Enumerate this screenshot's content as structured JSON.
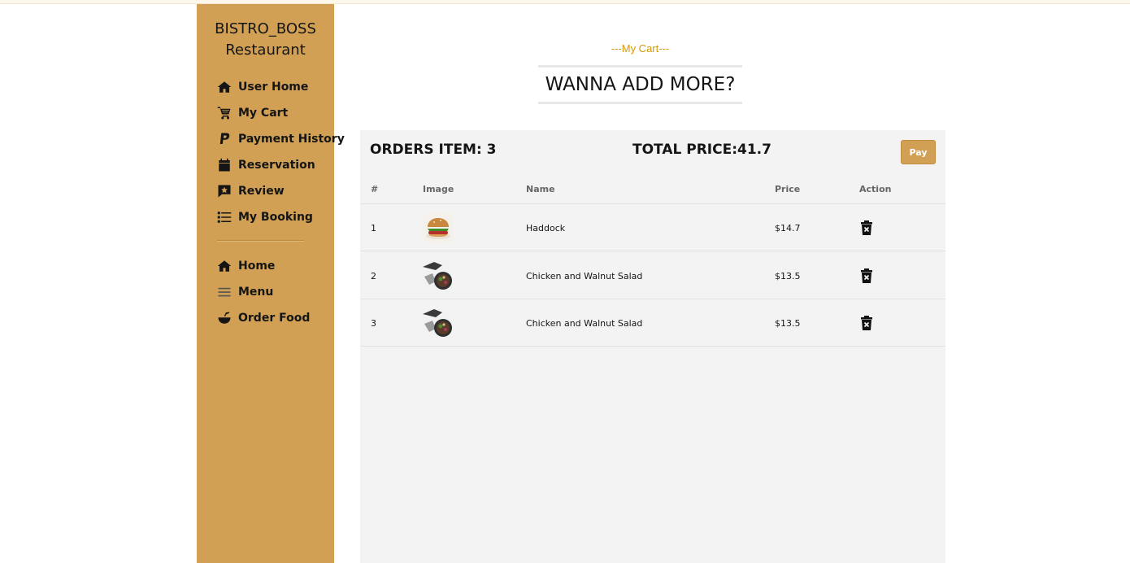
{
  "colors": {
    "sidebar": "#d1a054",
    "accent_orange": "#d99904",
    "panel": "#f3f3f3",
    "pay_button": "#d1a054"
  },
  "brand": {
    "line1": "BISTRO_BOSS",
    "line2": "Restaurant"
  },
  "sidebar": {
    "items": [
      {
        "label": "User Home",
        "icon": "house-icon"
      },
      {
        "label": "My Cart",
        "icon": "cart-icon"
      },
      {
        "label": "Payment History",
        "icon": "paypal-icon"
      },
      {
        "label": "Reservation",
        "icon": "calendar-icon"
      },
      {
        "label": "Review",
        "icon": "review-icon"
      },
      {
        "label": "My Booking",
        "icon": "list-icon"
      }
    ],
    "secondary": [
      {
        "label": "Home",
        "icon": "house-icon"
      },
      {
        "label": "Menu",
        "icon": "menu-icon"
      },
      {
        "label": "Order Food",
        "icon": "bowl-icon"
      }
    ]
  },
  "section": {
    "subtitle": "---My Cart---",
    "heading": "WANNA ADD MORE?"
  },
  "cart": {
    "orders_label": "ORDERS ITEM: 3",
    "total_label": "TOTAL PRICE:41.7",
    "pay_label": "Pay",
    "columns": [
      "#",
      "Image",
      "Name",
      "Price",
      "Action"
    ],
    "rows": [
      {
        "index": "1",
        "name": "Haddock",
        "price": "$14.7",
        "image": "burger-thumbnail"
      },
      {
        "index": "2",
        "name": "Chicken and Walnut Salad",
        "price": "$13.5",
        "image": "salad-thumbnail"
      },
      {
        "index": "3",
        "name": "Chicken and Walnut Salad",
        "price": "$13.5",
        "image": "salad-thumbnail"
      }
    ]
  }
}
